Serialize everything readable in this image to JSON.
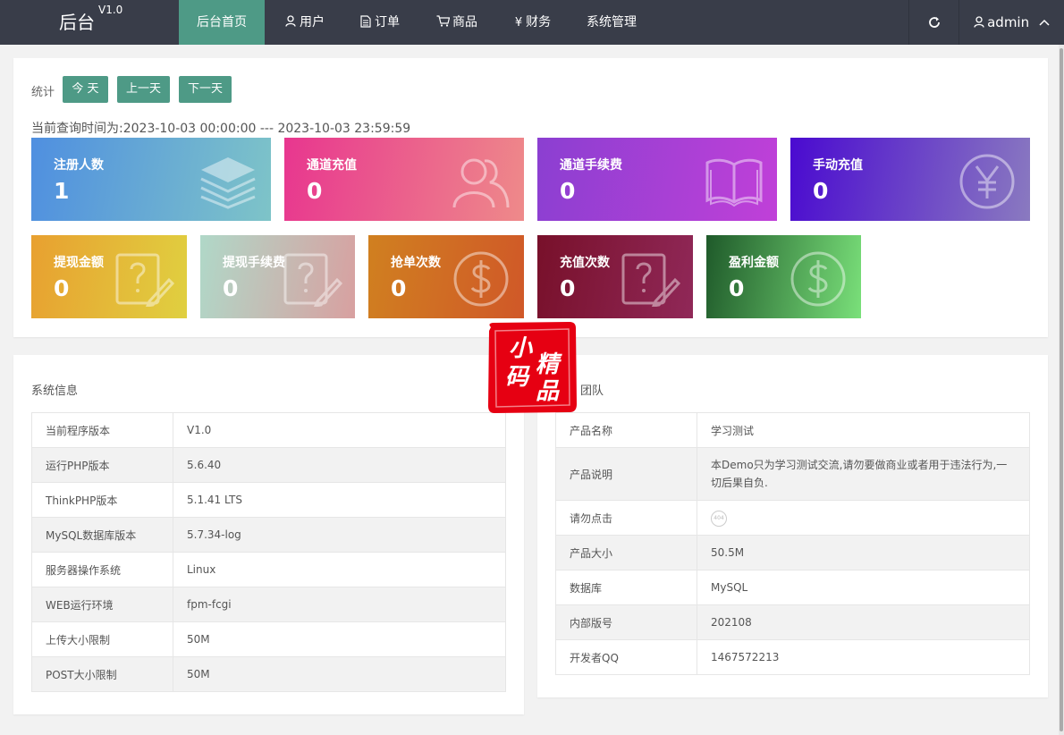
{
  "header": {
    "logo": "后台",
    "version": "V1.0",
    "nav": [
      {
        "label": "后台首页",
        "icon": "",
        "active": true
      },
      {
        "label": "用户",
        "icon": "user-icon"
      },
      {
        "label": "订单",
        "icon": "document-icon"
      },
      {
        "label": "商品",
        "icon": "cart-icon"
      },
      {
        "label": "财务",
        "icon": "yen-icon"
      },
      {
        "label": "系统管理",
        "icon": ""
      }
    ],
    "refresh_icon": "refresh-icon",
    "user": "admin"
  },
  "stats": {
    "label": "统计",
    "buttons": [
      "今 天",
      "上一天",
      "下一天"
    ],
    "query_time": "当前查询时间为:2023-10-03 00:00:00 --- 2023-10-03 23:59:59",
    "tiles": [
      {
        "label": "注册人数",
        "value": "1",
        "icon": "layers-icon",
        "colors": [
          "#4f8fe0",
          "#7ec4c8"
        ]
      },
      {
        "label": "通道充值",
        "value": "0",
        "icon": "users-icon",
        "colors": [
          "#e8368f",
          "#ee8a8a"
        ]
      },
      {
        "label": "通道手续费",
        "value": "0",
        "icon": "book-icon",
        "colors": [
          "#8b3fd1",
          "#c040d8"
        ]
      },
      {
        "label": "手动充值",
        "value": "0",
        "icon": "yen-circle-icon",
        "colors": [
          "#4a0ad0",
          "#8a7ac0"
        ]
      },
      {
        "label": "提现金额",
        "value": "0",
        "icon": "question-edit-icon",
        "colors": [
          "#e8a030",
          "#e0d040"
        ]
      },
      {
        "label": "提现手续费",
        "value": "0",
        "icon": "question-edit-icon",
        "colors": [
          "#b0d8c8",
          "#d8a0a0"
        ]
      },
      {
        "label": "抢单次数",
        "value": "0",
        "icon": "dollar-circle-icon",
        "colors": [
          "#d08020",
          "#d05828"
        ]
      },
      {
        "label": "充值次数",
        "value": "0",
        "icon": "question-edit-icon",
        "colors": [
          "#78102a",
          "#902858"
        ]
      },
      {
        "label": "盈利金额",
        "value": "0",
        "icon": "dollar-circle-icon",
        "colors": [
          "#1f5a2a",
          "#7ae07a"
        ]
      }
    ]
  },
  "system_info": {
    "title": "系统信息",
    "rows": [
      [
        "当前程序版本",
        "V1.0"
      ],
      [
        "运行PHP版本",
        "5.6.40"
      ],
      [
        "ThinkPHP版本",
        "5.1.41 LTS"
      ],
      [
        "MySQL数据库版本",
        "5.7.34-log"
      ],
      [
        "服务器操作系统",
        "Linux"
      ],
      [
        "WEB运行环境",
        "fpm-fcgi"
      ],
      [
        "上传大小限制",
        "50M"
      ],
      [
        "POST大小限制",
        "50M"
      ]
    ]
  },
  "team": {
    "title": "团队",
    "rows": [
      [
        "产品名称",
        "学习测试"
      ],
      [
        "产品说明",
        "本Demo只为学习测试交流,请勿要做商业或者用于违法行为,一切后果自负."
      ],
      [
        "请勿点击",
        "404"
      ],
      [
        "产品大小",
        "50.5M"
      ],
      [
        "数据库",
        "MySQL"
      ],
      [
        "内部版号",
        "202108"
      ],
      [
        "开发者QQ",
        "1467572213"
      ]
    ]
  },
  "stamp": {
    "chars": [
      "小",
      "精",
      "码",
      "品"
    ]
  }
}
